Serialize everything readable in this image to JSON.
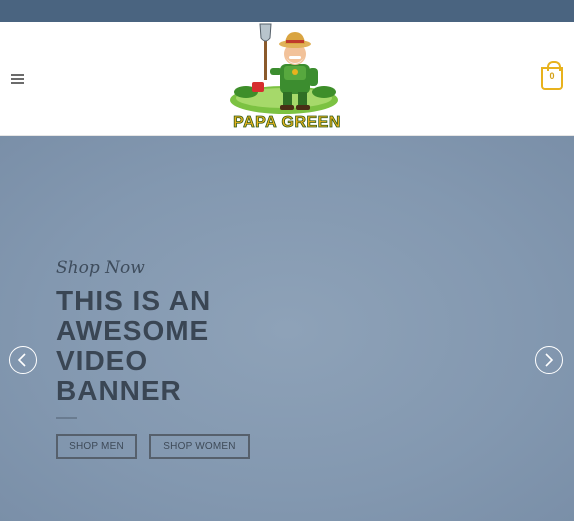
{
  "header": {
    "logo_text": "PAPA GREEN",
    "cart_count": "0"
  },
  "banner": {
    "eyebrow": "Shop Now",
    "headline": [
      "THIS IS AN",
      "AWESOME",
      "VIDEO",
      "BANNER"
    ],
    "buttons": {
      "men": "SHOP MEN",
      "women": "SHOP WOMEN"
    }
  },
  "colors": {
    "topbar": "#4a6480",
    "accent": "#e8b21d",
    "banner_bg": "#8398b0",
    "headline": "#3a4654"
  },
  "icons": [
    "menu-icon",
    "cart-icon",
    "chevron-left-icon",
    "chevron-right-icon"
  ]
}
